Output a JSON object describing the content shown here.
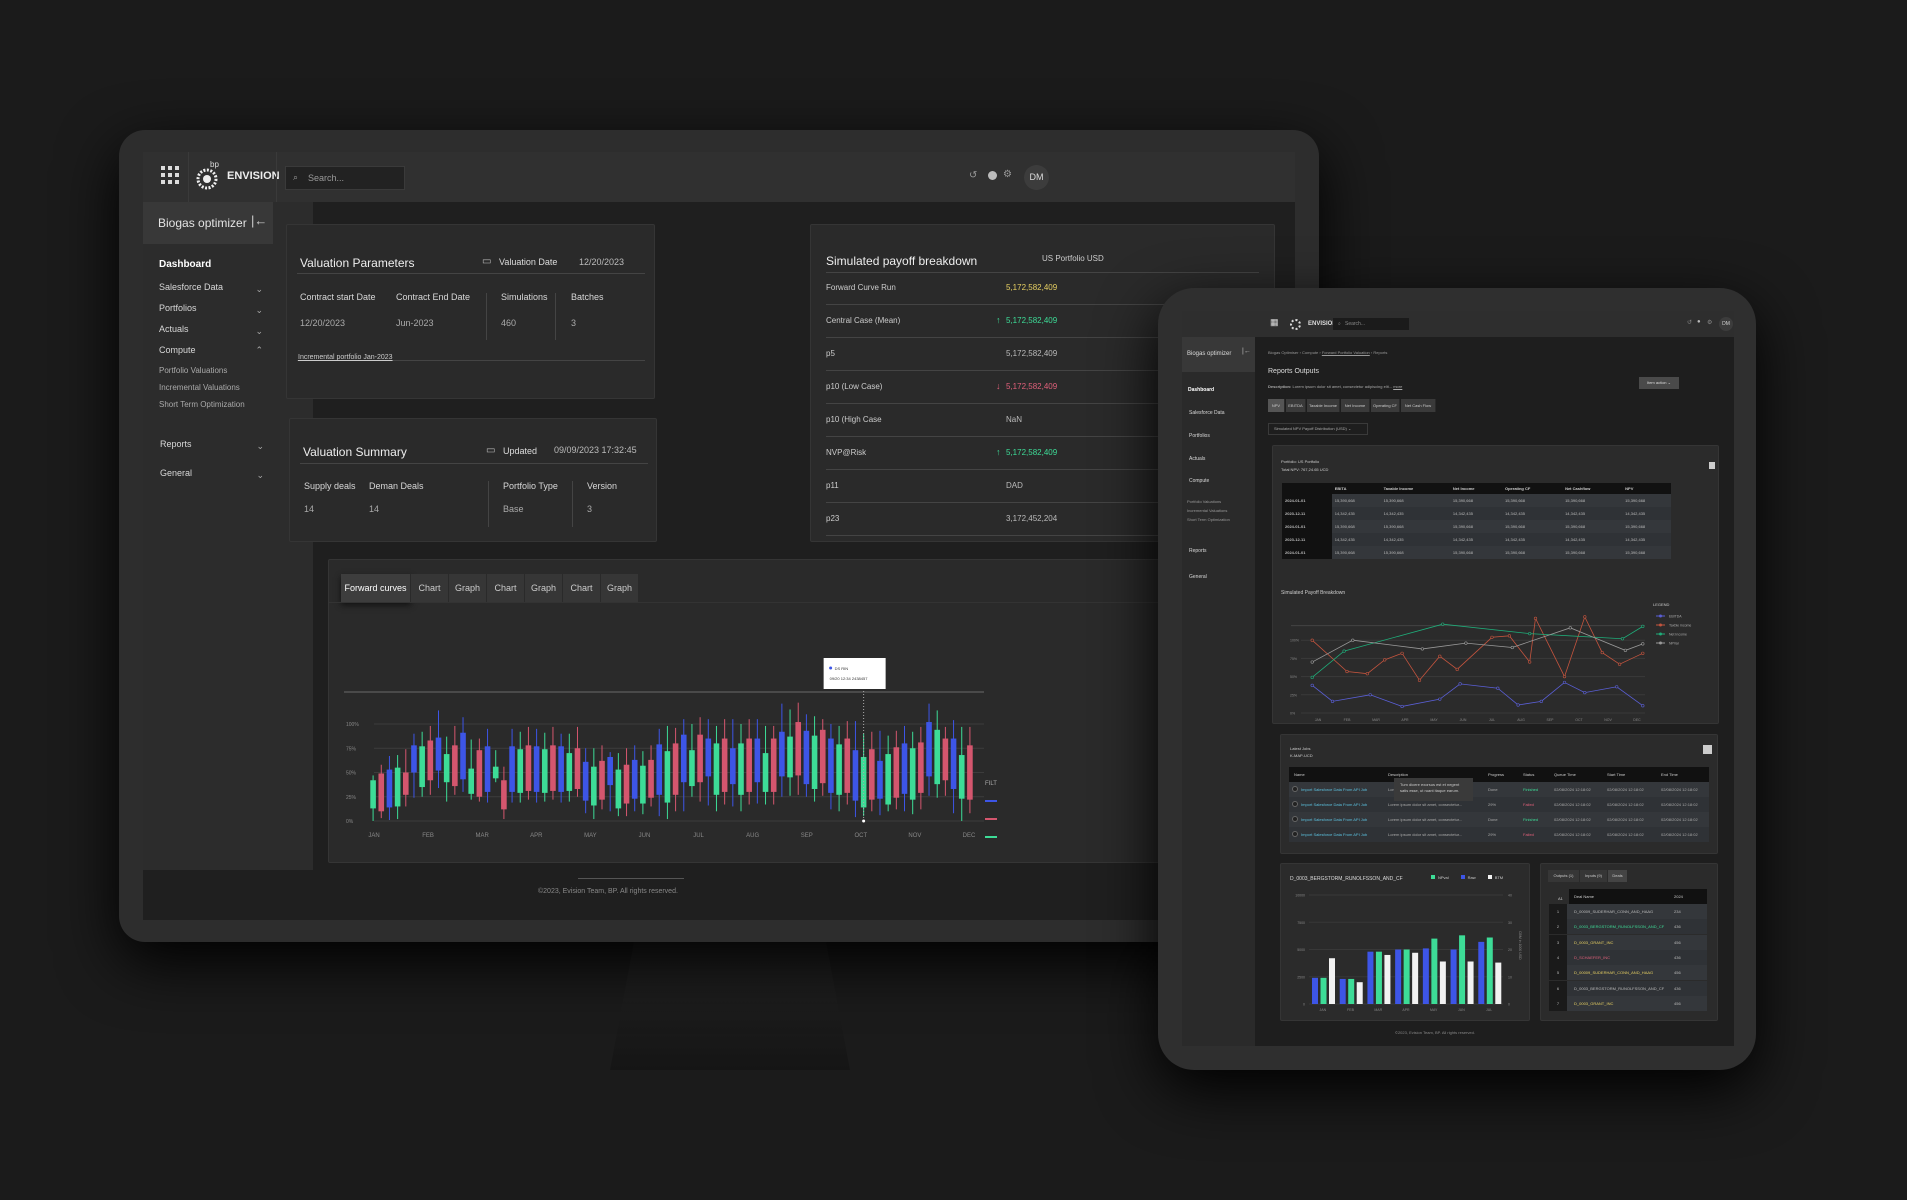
{
  "app": {
    "brand_small": "bp",
    "brand": "ENVISION",
    "search_placeholder": "Search...",
    "user_initials": "DM",
    "module_title": "Biogas optimizer"
  },
  "sidebar": {
    "items": [
      {
        "label": "Dashboard"
      },
      {
        "label": "Salesforce Data"
      },
      {
        "label": "Portfolios"
      },
      {
        "label": "Actuals"
      },
      {
        "label": "Compute",
        "expanded": true,
        "children": [
          "Portfolio Valuations",
          "Incremental Valuations",
          "Short Term Optimization"
        ]
      },
      {
        "label": "Reports"
      },
      {
        "label": "General"
      }
    ]
  },
  "valuation_parameters": {
    "title": "Valuation Parameters",
    "date_label": "Valuation Date",
    "date_value": "12/20/2023",
    "fields": [
      {
        "label": "Contract start Date",
        "value": "12/20/2023"
      },
      {
        "label": "Contract End Date",
        "value": "Jun-2023"
      },
      {
        "label": "Simulations",
        "value": "460"
      },
      {
        "label": "Batches",
        "value": "3"
      }
    ],
    "link": "Incremental portfolio Jan-2023"
  },
  "valuation_summary": {
    "title": "Valuation Summary",
    "date_label": "Updated",
    "date_value": "09/09/2023 17:32:45",
    "fields": [
      {
        "label": "Supply deals",
        "value": "14"
      },
      {
        "label": "Deman Deals",
        "value": "14"
      },
      {
        "label": "Portfolio Type",
        "value": "Base"
      },
      {
        "label": "Version",
        "value": "3"
      }
    ]
  },
  "payoff": {
    "title": "Simulated payoff breakdown",
    "column": "US Portfolio USD",
    "rows": [
      {
        "label": "Forward Curve Run",
        "value": "5,172,582,409",
        "tone": "yellow",
        "trend": ""
      },
      {
        "label": "Central Case (Mean)",
        "value": "5,172,582,409",
        "tone": "green",
        "trend": "↑"
      },
      {
        "label": "p5",
        "value": "5,172,582,409",
        "tone": "",
        "trend": ""
      },
      {
        "label": "p10 (Low Case)",
        "value": "5,172,582,409",
        "tone": "red",
        "trend": "↓"
      },
      {
        "label": "p10 (High Case",
        "value": "NaN",
        "tone": "",
        "trend": ""
      },
      {
        "label": "NVP@Risk",
        "value": "5,172,582,409",
        "tone": "green",
        "trend": "↑"
      },
      {
        "label": "p11",
        "value": "DAD",
        "tone": "",
        "trend": ""
      },
      {
        "label": "p23",
        "value": "3,172,452,204",
        "tone": "",
        "trend": ""
      }
    ]
  },
  "forward_chart": {
    "tabs": [
      "Forward curves",
      "Chart",
      "Graph",
      "Chart",
      "Graph",
      "Chart",
      "Graph"
    ],
    "active_tab": 0,
    "y_ticks": [
      "0%",
      "25%",
      "50%",
      "75%",
      "100%"
    ],
    "months": [
      "JAN",
      "FEB",
      "MAR",
      "APR",
      "MAY",
      "JUN",
      "JUL",
      "AUG",
      "SEP",
      "OCT",
      "NOV",
      "DEC"
    ],
    "tooltip": {
      "series": "DS RIN",
      "text": "09/20 12:34 2438457"
    },
    "filter_label": "FILT",
    "colors": {
      "green": "#3ddc97",
      "red": "#d4566e",
      "blue": "#3d55e6"
    },
    "candles": [
      [
        "g",
        13,
        42,
        0,
        47
      ],
      [
        "r",
        10,
        49,
        3,
        58
      ],
      [
        "b",
        14,
        53,
        1,
        67
      ],
      [
        "g",
        15,
        55,
        2,
        68
      ],
      [
        "r",
        27,
        50,
        15,
        74
      ],
      [
        "b",
        50,
        78,
        24,
        90
      ],
      [
        "g",
        35,
        77,
        25,
        92
      ],
      [
        "r",
        42,
        83,
        27,
        98
      ],
      [
        "b",
        52,
        86,
        34,
        114
      ],
      [
        "g",
        40,
        69,
        20,
        87
      ],
      [
        "r",
        36,
        78,
        27,
        98
      ],
      [
        "b",
        43,
        91,
        30,
        107
      ],
      [
        "g",
        28,
        54,
        22,
        84
      ],
      [
        "r",
        25,
        73,
        20,
        85
      ],
      [
        "b",
        30,
        77,
        19,
        95
      ],
      [
        "g",
        44,
        56,
        40,
        73
      ],
      [
        "r",
        12,
        42,
        2,
        56
      ],
      [
        "b",
        30,
        77,
        19,
        95
      ],
      [
        "g",
        29,
        74,
        19,
        92
      ],
      [
        "r",
        31,
        78,
        22,
        97
      ],
      [
        "b",
        30,
        77,
        19,
        95
      ],
      [
        "g",
        29,
        74,
        20,
        91
      ],
      [
        "r",
        31,
        78,
        22,
        97
      ],
      [
        "b",
        30,
        77,
        19,
        90
      ],
      [
        "g",
        31,
        70,
        20,
        90
      ],
      [
        "r",
        33,
        75,
        25,
        97
      ],
      [
        "b",
        21,
        61,
        8,
        75
      ],
      [
        "g",
        16,
        56,
        2,
        75
      ],
      [
        "r",
        22,
        62,
        12,
        78
      ],
      [
        "b",
        37,
        66,
        10,
        71
      ],
      [
        "g",
        13,
        53,
        5,
        70
      ],
      [
        "r",
        18,
        58,
        5,
        75
      ],
      [
        "b",
        23,
        63,
        10,
        78
      ],
      [
        "g",
        18,
        57,
        7,
        72
      ],
      [
        "r",
        24,
        63,
        15,
        78
      ],
      [
        "b",
        27,
        79,
        5,
        95
      ],
      [
        "g",
        19,
        72,
        2,
        98
      ],
      [
        "r",
        27,
        80,
        10,
        96
      ],
      [
        "b",
        40,
        89,
        10,
        105
      ],
      [
        "g",
        36,
        73,
        25,
        100
      ],
      [
        "r",
        40,
        89,
        20,
        107
      ],
      [
        "b",
        46,
        85,
        16,
        105
      ],
      [
        "g",
        27,
        80,
        10,
        98
      ],
      [
        "r",
        30,
        85,
        17,
        105
      ],
      [
        "b",
        38,
        75,
        15,
        105
      ],
      [
        "g",
        27,
        80,
        10,
        100
      ],
      [
        "r",
        30,
        85,
        17,
        105
      ],
      [
        "b",
        40,
        85,
        18,
        105
      ],
      [
        "g",
        30,
        70,
        17,
        98
      ],
      [
        "r",
        30,
        85,
        17,
        98
      ],
      [
        "b",
        46,
        92,
        25,
        121
      ],
      [
        "g",
        45,
        87,
        26,
        115
      ],
      [
        "r",
        47,
        102,
        27,
        122
      ],
      [
        "b",
        38,
        93,
        25,
        110
      ],
      [
        "g",
        33,
        88,
        20,
        108
      ],
      [
        "r",
        39,
        94,
        26,
        105
      ],
      [
        "b",
        29,
        85,
        12,
        100
      ],
      [
        "g",
        27,
        79,
        10,
        98
      ],
      [
        "r",
        29,
        85,
        17,
        103
      ],
      [
        "b",
        21,
        73,
        4,
        103
      ],
      [
        "g",
        14,
        66,
        5,
        90
      ],
      [
        "r",
        22,
        74,
        10,
        92
      ],
      [
        "b",
        23,
        62,
        6,
        93
      ],
      [
        "g",
        17,
        69,
        10,
        88
      ],
      [
        "r",
        24,
        76,
        12,
        93
      ],
      [
        "b",
        28,
        80,
        10,
        98
      ],
      [
        "g",
        22,
        75,
        7,
        92
      ],
      [
        "r",
        29,
        81,
        12,
        97
      ],
      [
        "b",
        46,
        102,
        26,
        121
      ],
      [
        "g",
        38,
        94,
        24,
        114
      ],
      [
        "r",
        42,
        85,
        26,
        97
      ],
      [
        "b",
        33,
        85,
        8,
        104
      ],
      [
        "g",
        23,
        68,
        0,
        97
      ],
      [
        "r",
        22,
        78,
        8,
        97
      ]
    ]
  },
  "footer": "©2023, Evision Team, BP. All rights reserved.",
  "tablet": {
    "breadcrumb": [
      "Biogas Optimiser",
      "Compute",
      "Forward Portfolio Valuation",
      "Reports"
    ],
    "title": "Reports Outputs",
    "description_label": "Description:",
    "description": "Lorem ipsum dolor sit amet, consectetur adipiscing elit...",
    "more": "more",
    "item_action": "Item action",
    "tabs": [
      "NPV",
      "EBITDA",
      "Taxable Income",
      "Net Income",
      "Operating CF",
      "Net Cash Flow"
    ],
    "dropdown": "Simulated NPV Payoff Distribution (USD)",
    "portfolio_line": "Portfolio: US Portfolio",
    "total_npv": "Total NPV: 767,24.65 UCD",
    "table": {
      "headers": [
        "",
        "EBITA",
        "Taxable Income",
        "Net Income",
        "Operating CF",
        "Net Cashflow",
        "NPV"
      ],
      "rows": [
        [
          "2024-01-01",
          "15,390,668",
          "15,390,668",
          "15,390,668",
          "15,390,668",
          "15,390,668",
          "15,390,668"
        ],
        [
          "2023-12-11",
          "14,342,435",
          "14,342,435",
          "14,342,435",
          "14,342,435",
          "14,342,435",
          "14,342,435"
        ],
        [
          "2024-01-01",
          "15,390,668",
          "15,390,668",
          "15,390,668",
          "15,390,668",
          "15,390,668",
          "15,390,668"
        ],
        [
          "2023-12-11",
          "14,342,435",
          "14,342,435",
          "14,342,435",
          "14,342,435",
          "14,342,435",
          "14,342,435"
        ],
        [
          "2024-01-01",
          "15,390,668",
          "15,390,668",
          "15,390,668",
          "15,390,668",
          "15,390,668",
          "15,390,668"
        ]
      ]
    },
    "line_chart": {
      "title": "Simulated Payoff Breakdown",
      "legend_title": "LEGEND",
      "y_ticks": [
        "0%",
        "25%",
        "50%",
        "75%",
        "100%"
      ],
      "months": [
        "JAN",
        "FEB",
        "MAR",
        "APR",
        "MAY",
        "JUN",
        "JUL",
        "AUG",
        "SEP",
        "OCT",
        "NOV",
        "DEC"
      ],
      "series": [
        {
          "name": "EBITDA",
          "color": "#5a5fd6",
          "points": [
            [
              -0.2,
              38
            ],
            [
              0.5,
              16
            ],
            [
              1.8,
              25
            ],
            [
              2.9,
              9
            ],
            [
              4.2,
              19
            ],
            [
              4.9,
              40
            ],
            [
              6.2,
              34
            ],
            [
              6.9,
              11
            ],
            [
              7.7,
              16
            ],
            [
              8.5,
              42
            ],
            [
              9.2,
              28
            ],
            [
              10.3,
              36
            ],
            [
              11.2,
              10
            ]
          ]
        },
        {
          "name": "Taxble income",
          "color": "#c4543e",
          "points": [
            [
              -0.2,
              100
            ],
            [
              1,
              57
            ],
            [
              1.7,
              54
            ],
            [
              2.3,
              73
            ],
            [
              2.9,
              82
            ],
            [
              3.5,
              45
            ],
            [
              4.2,
              78
            ],
            [
              4.8,
              60
            ],
            [
              6,
              104
            ],
            [
              6.6,
              106
            ],
            [
              7.3,
              70
            ],
            [
              7.5,
              130
            ],
            [
              8.5,
              50
            ],
            [
              9.2,
              132
            ],
            [
              9.8,
              83
            ],
            [
              10.4,
              67
            ],
            [
              11.2,
              82
            ]
          ]
        },
        {
          "name": "Net Income",
          "color": "#1fae7a",
          "points": [
            [
              -0.2,
              49
            ],
            [
              0.9,
              85
            ],
            [
              4.3,
              122
            ],
            [
              7.3,
              109
            ],
            [
              10.5,
              102
            ],
            [
              11.2,
              119
            ]
          ]
        },
        {
          "name": "NPVar",
          "color": "#9a9a9a",
          "points": [
            [
              -0.2,
              70
            ],
            [
              1.2,
              100
            ],
            [
              3.6,
              88
            ],
            [
              5.1,
              96
            ],
            [
              6.7,
              90
            ],
            [
              8.7,
              117
            ],
            [
              10.6,
              86
            ],
            [
              11.2,
              95
            ]
          ]
        }
      ]
    },
    "jobs": {
      "title": "Latest Jobs",
      "subtitle": "K-MAP-UCD",
      "headers": [
        "Name",
        "Description",
        "Progress",
        "Status",
        "Queue Time",
        "Start Time",
        "End Time"
      ],
      "tooltip": "Tum dicere exorsus est et negent satis esse, ut ruant itaque earum.",
      "rows": [
        [
          "Import Salesforce Data From API Job",
          "Lorem ipsum dolor sit amet, consectetur...",
          "Done",
          "Finished",
          "02/08/2024 12:18:02",
          "02/08/2024 12:18:02",
          "02/08/2024 12:18:02"
        ],
        [
          "Import Salesforce Data From API Job",
          "Lorem ipsum dolor sit amet, consectetur...",
          "29%",
          "Failed",
          "02/08/2024 12:18:02",
          "02/08/2024 12:18:02",
          "02/08/2024 12:18:02"
        ],
        [
          "Import Salesforce Data From API Job",
          "Lorem ipsum dolor sit amet, consectetur...",
          "Done",
          "Finished",
          "02/08/2024 12:18:02",
          "02/08/2024 12:18:02",
          "02/08/2024 12:18:02"
        ],
        [
          "Import Salesforce Data From API Job",
          "Lorem ipsum dolor sit amet, consectetur...",
          "29%",
          "Failed",
          "02/08/2024 12:18:02",
          "02/08/2024 12:18:02",
          "02/08/2024 12:18:02"
        ]
      ],
      "status_colors": {
        "Finished": "#3ddc97",
        "Failed": "#e0607a"
      }
    },
    "bar_chart": {
      "title": "D_0003_BERGSTORM_RUNOLFSSON_AND_CF",
      "left_ticks": [
        "0",
        "2500",
        "5000",
        "7500",
        "10000"
      ],
      "right_ticks": [
        "0",
        "10",
        "20",
        "30",
        "40"
      ],
      "right_label": "CBM in 1000 USD",
      "months": [
        "JAN",
        "FEB",
        "MAR",
        "APR",
        "MAY",
        "JUN",
        "JUL"
      ],
      "series": [
        {
          "name": "Raw",
          "color": "#3d55e6",
          "values": [
            2400,
            2300,
            4800,
            5000,
            5100,
            5000,
            5700
          ]
        },
        {
          "name": "NPval",
          "color": "#3ddc97",
          "values": [
            2400,
            2300,
            4800,
            5000,
            6000,
            6300,
            6100
          ]
        },
        {
          "name": "BTM",
          "color": "#f2f2f2",
          "values": [
            4200,
            2000,
            4500,
            4700,
            3900,
            3900,
            3800
          ]
        }
      ],
      "legend_order": [
        "NPval",
        "Raw",
        "BTM"
      ]
    },
    "deals": {
      "tabs": [
        "Outputs (1)",
        "Inputs (9)",
        "Deals"
      ],
      "headers": [
        "Deal Name",
        "2024"
      ],
      "row_label": "A1",
      "rows": [
        [
          "1",
          "D_00009_SUDERHAR_CONN_AND_HAAG",
          "234",
          ""
        ],
        [
          "2",
          "D_0003_BERGSTORM_RUNOLFSSON_AND_CF",
          "436",
          "#3ddc97"
        ],
        [
          "3",
          "D_0003_GRANT_INC",
          "456",
          "#e6cf62"
        ],
        [
          "4",
          "D_SCHAEFER_INC",
          "436",
          "#e0607a"
        ],
        [
          "5",
          "D_00009_SUDERHAR_CONN_AND_HAAG",
          "456",
          "#e6cf62"
        ],
        [
          "6",
          "D_0003_BERGSTORM_RUNOLFSSON_AND_CF",
          "436",
          ""
        ],
        [
          "7",
          "D_0003_GRANT_INC",
          "456",
          "#e6cf62"
        ]
      ]
    }
  }
}
